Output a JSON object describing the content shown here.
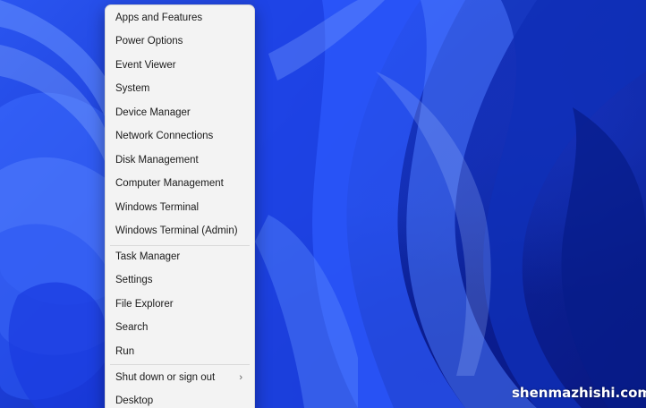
{
  "menu": {
    "items": [
      {
        "label": "Apps and Features"
      },
      {
        "label": "Power Options"
      },
      {
        "label": "Event Viewer"
      },
      {
        "label": "System"
      },
      {
        "label": "Device Manager"
      },
      {
        "label": "Network Connections"
      },
      {
        "label": "Disk Management"
      },
      {
        "label": "Computer Management"
      },
      {
        "label": "Windows Terminal"
      },
      {
        "label": "Windows Terminal (Admin)"
      },
      {
        "label": "Task Manager"
      },
      {
        "label": "Settings"
      },
      {
        "label": "File Explorer"
      },
      {
        "label": "Search"
      },
      {
        "label": "Run"
      },
      {
        "label": "Shut down or sign out",
        "icon": "chevron-right-icon"
      },
      {
        "label": "Desktop"
      }
    ]
  },
  "watermark": {
    "text": "shenmazhishi.com"
  },
  "colors": {
    "menu_background": "#f3f3f3",
    "menu_text": "#1a1a1a",
    "wallpaper_blue": "#1b3fd0"
  }
}
